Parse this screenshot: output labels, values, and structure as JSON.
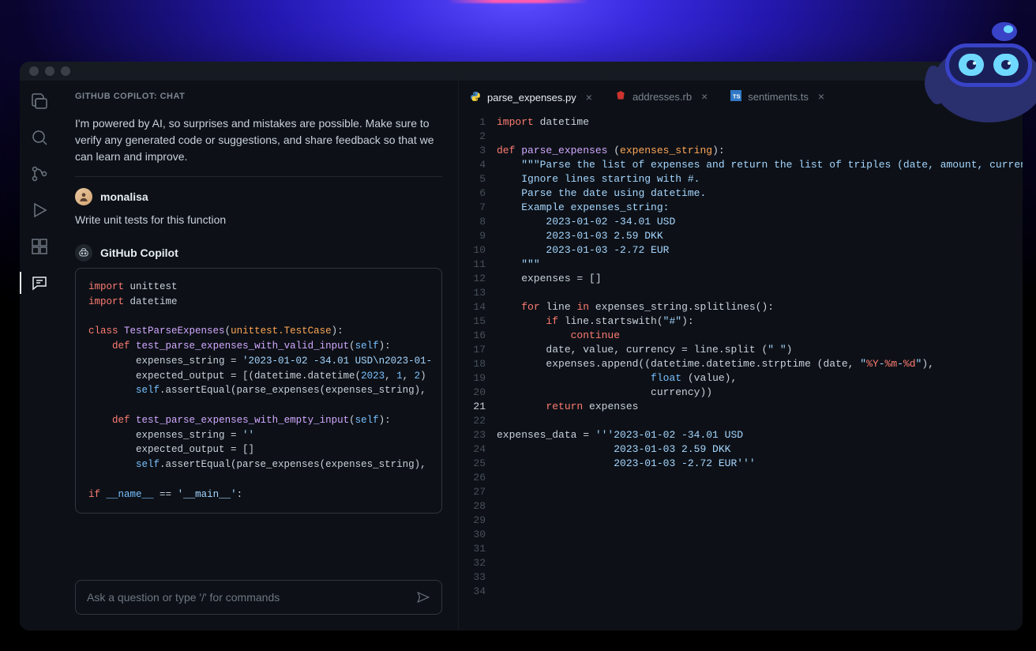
{
  "chat": {
    "title": "GITHUB COPILOT: CHAT",
    "intro": "I'm powered by AI, so surprises and mistakes are possible. Make sure to verify any generated code or suggestions, and share feedback so that we can learn and improve.",
    "user": {
      "name": "monalisa",
      "message": "Write unit tests for this function"
    },
    "assistant": {
      "name": "GitHub Copilot"
    },
    "input_placeholder": "Ask a question or type '/' for commands",
    "code_tokens": [
      [
        [
          "kw",
          "import"
        ],
        [
          "",
          " unittest"
        ]
      ],
      [
        [
          "kw",
          "import"
        ],
        [
          "",
          " datetime"
        ]
      ],
      [],
      [
        [
          "kw",
          "class"
        ],
        [
          "",
          " "
        ],
        [
          "fn",
          "TestParseExpenses"
        ],
        [
          "",
          ""
        ],
        [
          "",
          "("
        ],
        [
          "param",
          "unittest.TestCase"
        ],
        [
          "",
          "):"
        ]
      ],
      [
        [
          "",
          "    "
        ],
        [
          "kw",
          "def"
        ],
        [
          "",
          " "
        ],
        [
          "fn",
          "test_parse_expenses_with_valid_input"
        ],
        [
          "",
          "("
        ],
        [
          "self",
          "self"
        ],
        [
          "",
          "):"
        ]
      ],
      [
        [
          "",
          "        expenses_string = "
        ],
        [
          "str",
          "'2023-01-02 -34.01 USD\\n2023-01-"
        ]
      ],
      [
        [
          "",
          "        expected_output = [(datetime.datetime("
        ],
        [
          "num",
          "2023"
        ],
        [
          "",
          ", "
        ],
        [
          "num",
          "1"
        ],
        [
          "",
          ", "
        ],
        [
          "num",
          "2"
        ],
        [
          "",
          ")"
        ]
      ],
      [
        [
          "",
          "        "
        ],
        [
          "self",
          "self"
        ],
        [
          "",
          ".assertEqual(parse_expenses(expenses_string),"
        ]
      ],
      [],
      [
        [
          "",
          "    "
        ],
        [
          "kw",
          "def"
        ],
        [
          "",
          " "
        ],
        [
          "fn",
          "test_parse_expenses_with_empty_input"
        ],
        [
          "",
          "("
        ],
        [
          "self",
          "self"
        ],
        [
          "",
          "):"
        ]
      ],
      [
        [
          "",
          "        expenses_string = "
        ],
        [
          "str",
          "''"
        ]
      ],
      [
        [
          "",
          "        expected_output = []"
        ]
      ],
      [
        [
          "",
          "        "
        ],
        [
          "self",
          "self"
        ],
        [
          "",
          ".assertEqual(parse_expenses(expenses_string),"
        ]
      ],
      [],
      [
        [
          "kw",
          "if"
        ],
        [
          "",
          " "
        ],
        [
          "self",
          "__name__"
        ],
        [
          "",
          " == "
        ],
        [
          "str",
          "'__main__'"
        ],
        [
          "",
          ":"
        ]
      ]
    ]
  },
  "tabs": [
    {
      "label": "parse_expenses.py",
      "active": true,
      "lang": "py"
    },
    {
      "label": "addresses.rb",
      "active": false,
      "lang": "rb"
    },
    {
      "label": "sentiments.ts",
      "active": false,
      "lang": "ts"
    }
  ],
  "editor": {
    "current_line": 21,
    "total_lines": 34,
    "lines": [
      [
        [
          "kw",
          "import"
        ],
        [
          "",
          " datetime"
        ]
      ],
      [],
      [
        [
          "kw",
          "def"
        ],
        [
          "",
          " "
        ],
        [
          "fn",
          "parse_expenses"
        ],
        [
          "",
          " ("
        ],
        [
          "param",
          "expenses_string"
        ],
        [
          "",
          "):"
        ]
      ],
      [
        [
          "",
          "    "
        ],
        [
          "str",
          "\"\"\"Parse the list of expenses and return the list of triples (date, amount, currency"
        ]
      ],
      [
        [
          "",
          "    "
        ],
        [
          "str",
          "Ignore lines starting with #."
        ]
      ],
      [
        [
          "",
          "    "
        ],
        [
          "str",
          "Parse the date using datetime."
        ]
      ],
      [
        [
          "",
          "    "
        ],
        [
          "str",
          "Example expenses_string:"
        ]
      ],
      [
        [
          "",
          "    "
        ],
        [
          "str",
          "    2023-01-02 -34.01 USD"
        ]
      ],
      [
        [
          "",
          "    "
        ],
        [
          "str",
          "    2023-01-03 2.59 DKK"
        ]
      ],
      [
        [
          "",
          "    "
        ],
        [
          "str",
          "    2023-01-03 -2.72 EUR"
        ]
      ],
      [
        [
          "",
          "    "
        ],
        [
          "str",
          "\"\"\""
        ]
      ],
      [
        [
          "",
          "    expenses = []"
        ]
      ],
      [],
      [
        [
          "",
          "    "
        ],
        [
          "kw",
          "for"
        ],
        [
          "",
          " line "
        ],
        [
          "kw",
          "in"
        ],
        [
          "",
          " expenses_string.splitlines():"
        ]
      ],
      [
        [
          "",
          "        "
        ],
        [
          "kw",
          "if"
        ],
        [
          "",
          " line.startswith("
        ],
        [
          "str",
          "\"#\""
        ],
        [
          "",
          "):"
        ]
      ],
      [
        [
          "",
          "            "
        ],
        [
          "kw",
          "continue"
        ]
      ],
      [
        [
          "",
          "        date, value, currency = line.split ("
        ],
        [
          "str",
          "\" \""
        ],
        [
          "",
          ")"
        ]
      ],
      [
        [
          "",
          "        expenses.append((datetime.datetime.strptime (date, "
        ],
        [
          "fmt",
          "\""
        ],
        [
          "fmt-esc",
          "%Y"
        ],
        [
          "fmt",
          "-"
        ],
        [
          "fmt-esc",
          "%m"
        ],
        [
          "fmt",
          "-"
        ],
        [
          "fmt-esc",
          "%d"
        ],
        [
          "fmt",
          "\""
        ],
        [
          "",
          "),"
        ]
      ],
      [
        [
          "",
          "                         "
        ],
        [
          "builtin",
          "float"
        ],
        [
          "",
          " (value),"
        ]
      ],
      [
        [
          "",
          "                         currency))"
        ]
      ],
      [
        [
          "",
          "        "
        ],
        [
          "kw",
          "return"
        ],
        [
          "",
          " expenses"
        ]
      ],
      [],
      [
        [
          "",
          "expenses_data = "
        ],
        [
          "str",
          "'''2023-01-02 -34.01 USD"
        ]
      ],
      [
        [
          "",
          "                   "
        ],
        [
          "str",
          "2023-01-03 2.59 DKK"
        ]
      ],
      [
        [
          "",
          "                   "
        ],
        [
          "str",
          "2023-01-03 -2.72 EUR'''"
        ]
      ]
    ]
  }
}
